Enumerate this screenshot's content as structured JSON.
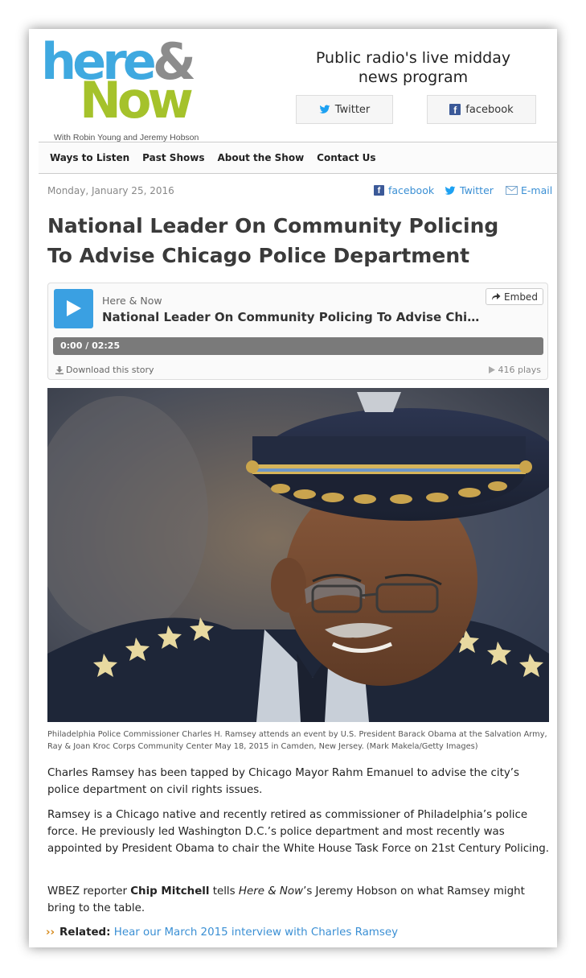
{
  "header": {
    "logo": {
      "here": "here",
      "amp": "&",
      "now": "Now",
      "subtitle": "With Robin Young and Jeremy Hobson"
    },
    "tagline": "Public radio's live midday news program",
    "twitter_label": "Twitter",
    "facebook_label": "facebook"
  },
  "nav": {
    "items": [
      "Ways to Listen",
      "Past Shows",
      "About the Show",
      "Contact Us"
    ]
  },
  "article": {
    "date": "Monday, January 25, 2016",
    "share": {
      "facebook": "facebook",
      "twitter": "Twitter",
      "email": "E-mail"
    },
    "headline": "National Leader On Community Policing To Advise Chicago Police Department",
    "player": {
      "show": "Here & Now",
      "title": "National Leader On Community Policing To Advise Chicago Police Department",
      "embed_label": "Embed",
      "time_current": "0:00",
      "time_total": "02:25",
      "time_sep": "/",
      "download_label": "Download this story",
      "plays": "416 plays",
      "progress": 0
    },
    "caption": "Philadelphia Police Commissioner Charles H. Ramsey attends an event by U.S. President Barack Obama at the Salvation Army, Ray & Joan Kroc Corps Community Center May 18, 2015 in Camden, New Jersey. (Mark Makela/Getty Images)",
    "paragraph1": "Charles Ramsey has been tapped by Chicago Mayor Rahm Emanuel to advise the city’s police department on civil rights issues.",
    "paragraph2": "Ramsey is a Chicago native and recently retired as commissioner of Philadelphia’s police force. He previously led Washington D.C.’s police department and most recently was appointed by President Obama to chair the White House Task Force on 21st Century Policing.",
    "paragraph3": {
      "pre": "WBEZ reporter ",
      "reporter": "Chip Mitchell",
      "mid": " tells ",
      "show": "Here & Now",
      "post": "’s Jeremy Hobson on what Ramsey might bring to the table."
    },
    "related": {
      "arrow": "››",
      "label": "Related:",
      "link": "Hear our March 2015 interview with Charles Ramsey"
    }
  },
  "colors": {
    "brand_blue": "#3fa9e0",
    "brand_green": "#a5c22b",
    "link": "#3a8fd4",
    "play_button": "#3aa0e2"
  }
}
